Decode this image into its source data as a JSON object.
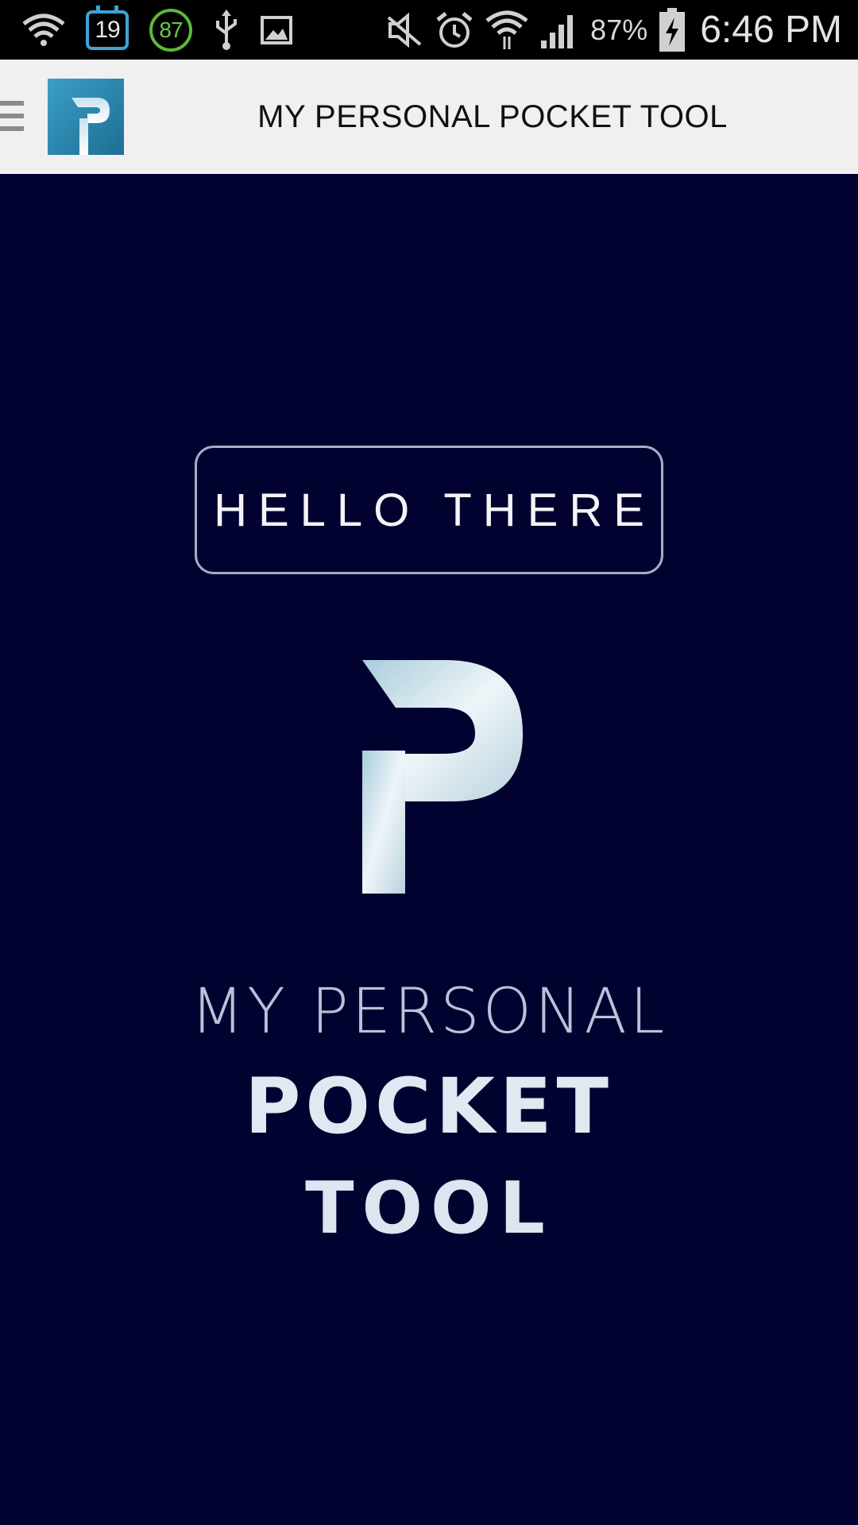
{
  "status_bar": {
    "calendar_day": "19",
    "circle_badge": "87",
    "battery_percent": "87%",
    "time": "6:46 PM",
    "icons": [
      "wifi-question-icon",
      "calendar-icon",
      "circle-87-icon",
      "usb-icon",
      "image-icon",
      "mute-icon",
      "alarm-icon",
      "wifi-icon",
      "signal-icon",
      "battery-charging-icon"
    ]
  },
  "header": {
    "menu_icon": "hamburger-icon",
    "logo_icon": "p-logo-icon",
    "title": "MY PERSONAL POCKET TOOL"
  },
  "main": {
    "hello_button": "HELLO THERE",
    "brand_logo_icon": "big-p-logo",
    "brand_line1": "MY PERSONAL",
    "brand_line2": "POCKET",
    "brand_line3": "TOOL"
  },
  "colors": {
    "background": "#020230",
    "header_bg": "#f0f0f0",
    "logo_blue": "#2a86ad"
  }
}
